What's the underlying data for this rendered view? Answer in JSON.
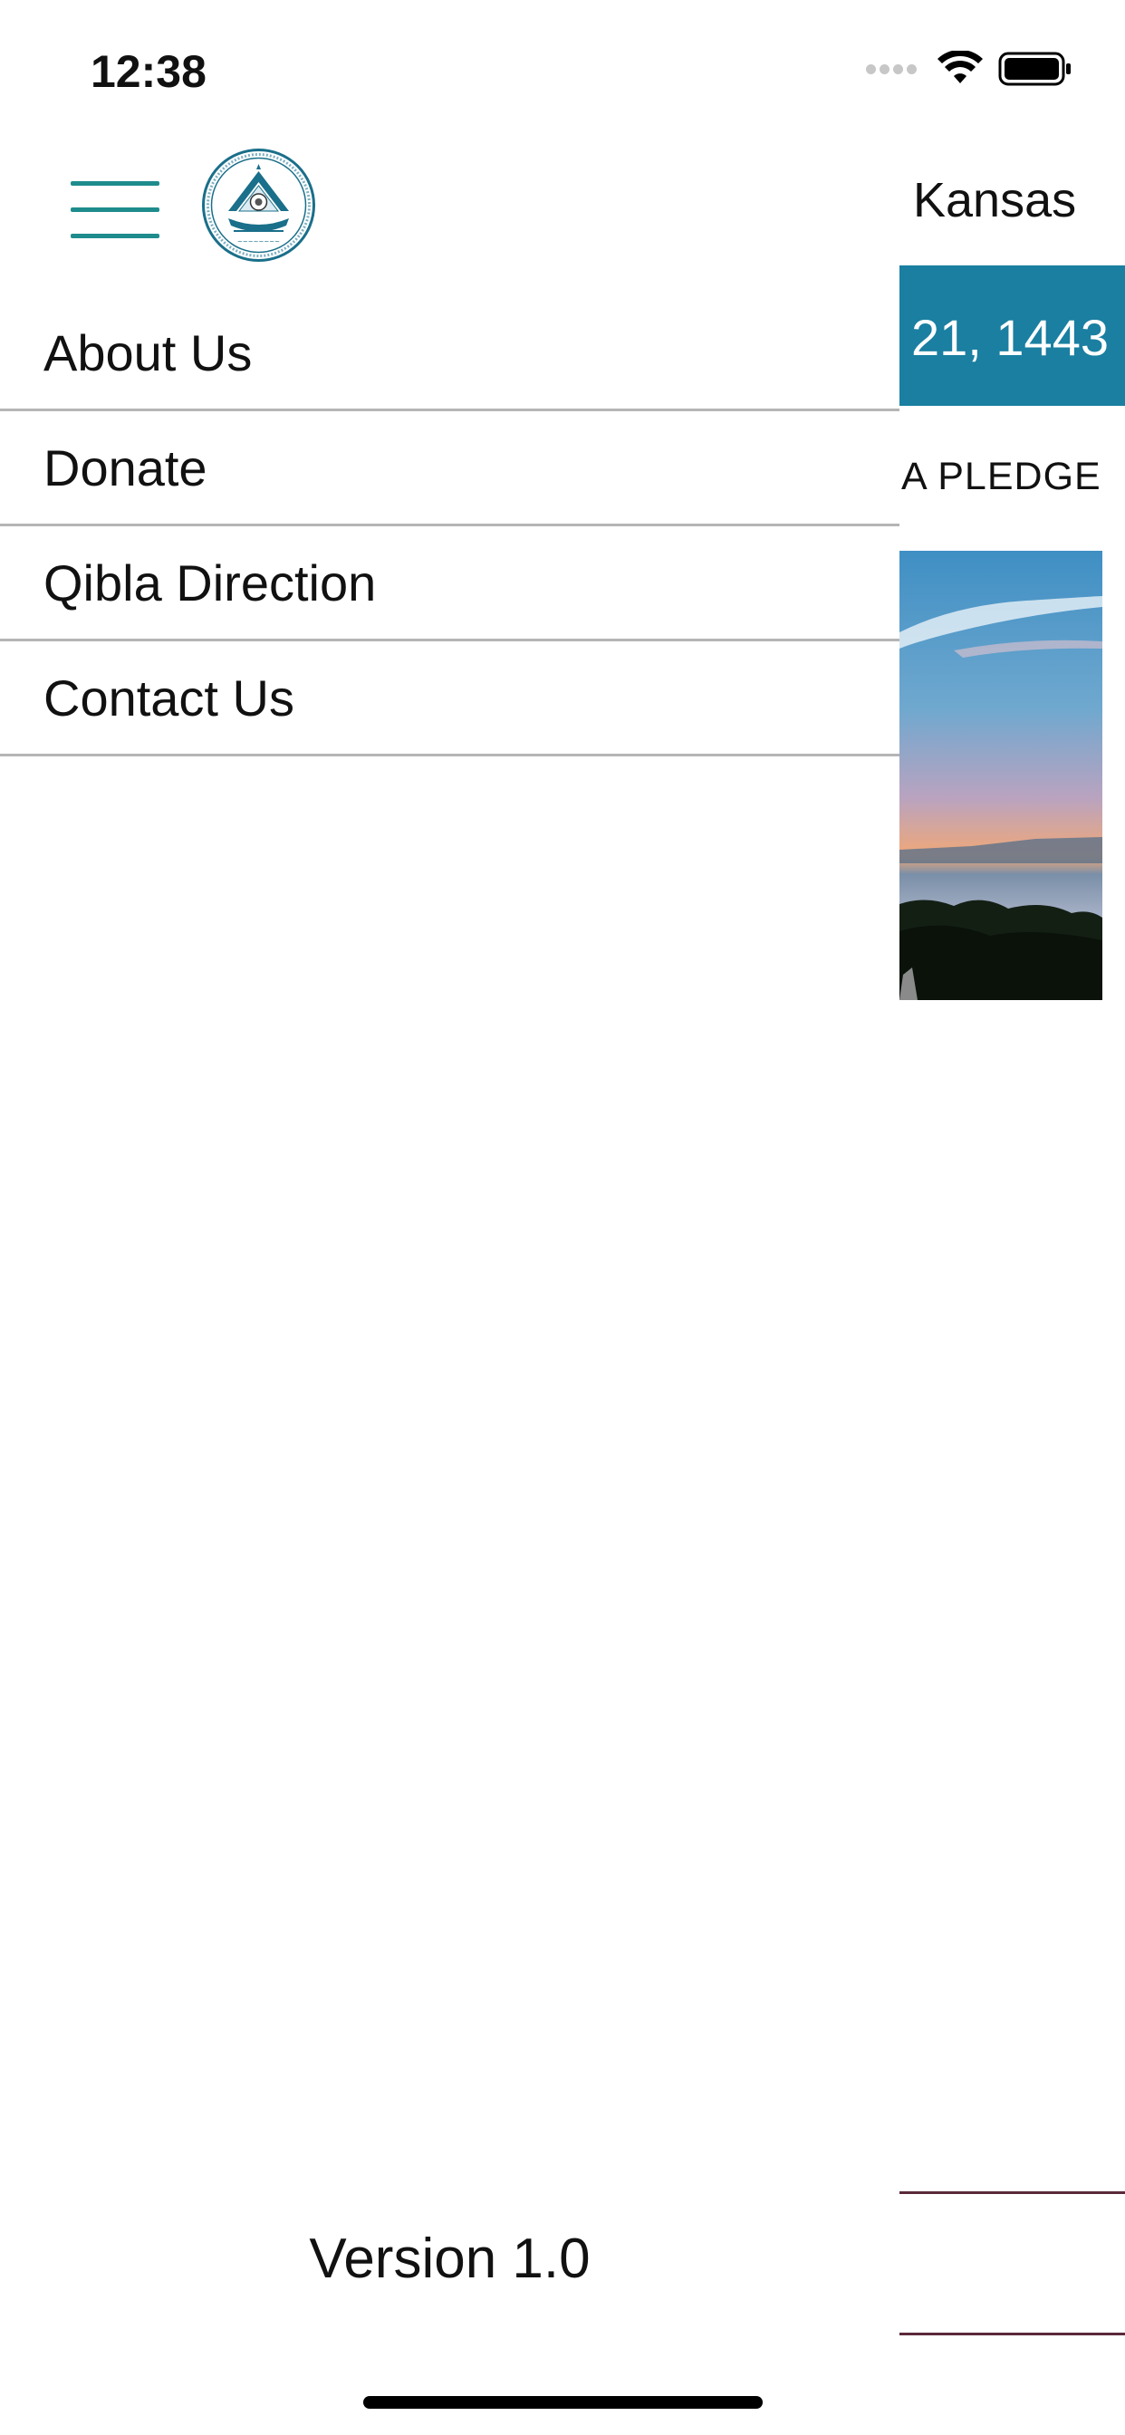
{
  "status_bar": {
    "time": "12:38",
    "signal_icon": "cellular-signal-icon",
    "wifi_icon": "wifi-icon",
    "battery_icon": "battery-icon"
  },
  "drawer": {
    "menu_icon": "hamburger-menu-icon",
    "logo_icon": "mosque-logo-icon",
    "items": [
      {
        "label": "About Us"
      },
      {
        "label": "Donate"
      },
      {
        "label": "Qibla Direction"
      },
      {
        "label": "Contact Us"
      }
    ],
    "version": "Version 1.0"
  },
  "main": {
    "location": "Kansas",
    "date": "21, 1443",
    "pledge": "A PLEDGE",
    "photo": "sunset-lake-photo"
  },
  "colors": {
    "accent": "#1e8c8c",
    "date_bar": "#1a7fa1",
    "divider": "#b5b5b5"
  }
}
